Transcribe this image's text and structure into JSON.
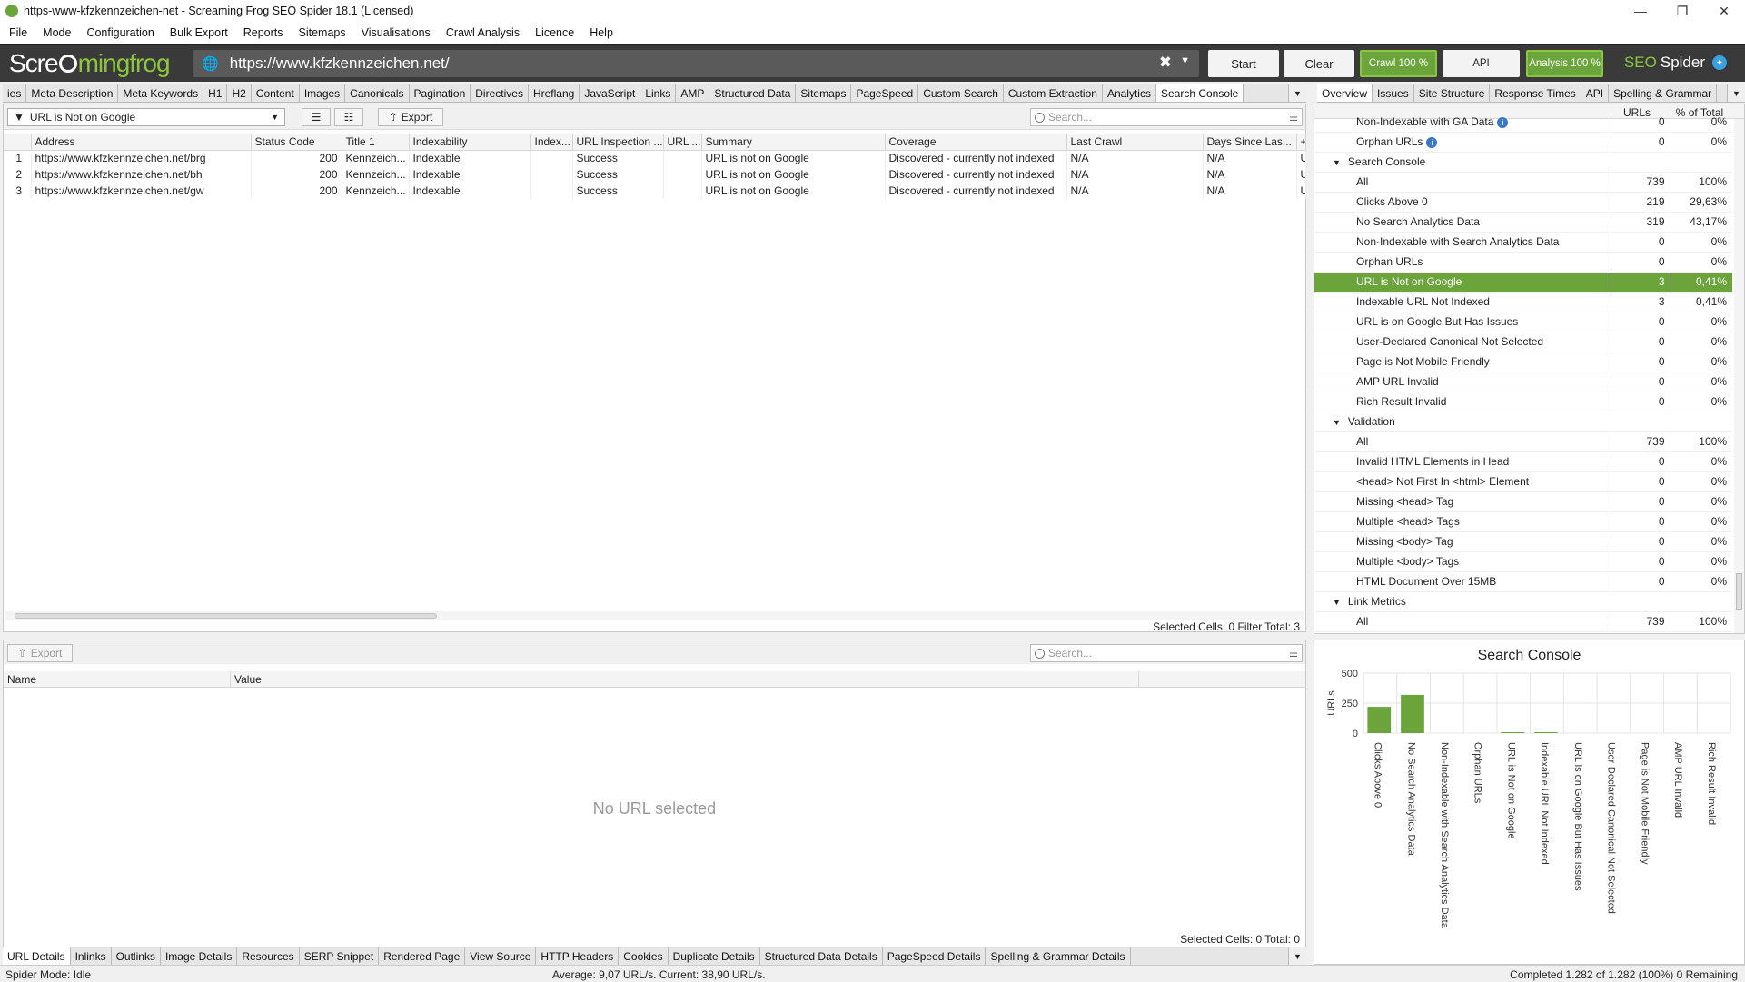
{
  "window": {
    "title": "https-www-kfzkennzeichen-net - Screaming Frog SEO Spider 18.1 (Licensed)"
  },
  "menu": [
    "File",
    "Mode",
    "Configuration",
    "Bulk Export",
    "Reports",
    "Sitemaps",
    "Visualisations",
    "Crawl Analysis",
    "Licence",
    "Help"
  ],
  "toolbar": {
    "brand_pre": "Scre",
    "brand_post": "mingfrog",
    "url": "https://www.kfzkennzeichen.net/",
    "start": "Start",
    "clear": "Clear",
    "crawl": "Crawl 100 %",
    "api": "API",
    "analysis": "Analysis 100 %",
    "seo": "SEO",
    "spider": "Spider"
  },
  "left_tabs": [
    "ies",
    "Meta Description",
    "Meta Keywords",
    "H1",
    "H2",
    "Content",
    "Images",
    "Canonicals",
    "Pagination",
    "Directives",
    "Hreflang",
    "JavaScript",
    "Links",
    "AMP",
    "Structured Data",
    "Sitemaps",
    "PageSpeed",
    "Custom Search",
    "Custom Extraction",
    "Analytics",
    "Search Console"
  ],
  "right_tabs": [
    "Overview",
    "Issues",
    "Site Structure",
    "Response Times",
    "API",
    "Spelling & Grammar"
  ],
  "filter": {
    "selected": "URL is Not on Google",
    "export": "Export",
    "search_placeholder": "Search..."
  },
  "main_table": {
    "columns": [
      "",
      "Address",
      "Status Code",
      "Title 1",
      "Indexability",
      "Index...",
      "URL Inspection ...",
      "URL ...",
      "Summary",
      "Coverage",
      "Last Crawl",
      "Days Since Las...",
      "+"
    ],
    "rows": [
      [
        "1",
        "https://www.kfzkennzeichen.net/brg",
        "200",
        "Kennzeich...",
        "Indexable",
        "",
        "Success",
        "",
        "URL is not on Google",
        "Discovered - currently not indexed",
        "N/A",
        "N/A",
        "Ur"
      ],
      [
        "2",
        "https://www.kfzkennzeichen.net/bh",
        "200",
        "Kennzeich...",
        "Indexable",
        "",
        "Success",
        "",
        "URL is not on Google",
        "Discovered - currently not indexed",
        "N/A",
        "N/A",
        "Ur"
      ],
      [
        "3",
        "https://www.kfzkennzeichen.net/gw",
        "200",
        "Kennzeich...",
        "Indexable",
        "",
        "Success",
        "",
        "URL is not on Google",
        "Discovered - currently not indexed",
        "N/A",
        "N/A",
        "Ur"
      ]
    ],
    "selected_cells": "Selected Cells:  0  Filter Total:  3"
  },
  "lower": {
    "export": "Export",
    "search_placeholder": "Search...",
    "col_name": "Name",
    "col_value": "Value",
    "empty": "No URL selected",
    "total": "Selected Cells:  0  Total:  0"
  },
  "bottom_tabs": [
    "URL Details",
    "Inlinks",
    "Outlinks",
    "Image Details",
    "Resources",
    "SERP Snippet",
    "Rendered Page",
    "View Source",
    "HTTP Headers",
    "Cookies",
    "Duplicate Details",
    "Structured Data Details",
    "PageSpeed Details",
    "Spelling & Grammar Details"
  ],
  "status": {
    "mode": "Spider Mode: Idle",
    "speed": "Average: 9,07 URL/s. Current: 38,90 URL/s.",
    "completed": "Completed 1.282 of 1.282 (100%) 0 Remaining"
  },
  "overview": {
    "col_urls": "URLs",
    "col_pct": "% of Total",
    "rows": [
      {
        "type": "item",
        "label": "Non-Indexable with GA Data",
        "urls": "0",
        "pct": "0%",
        "info": true
      },
      {
        "type": "item",
        "label": "Orphan URLs",
        "urls": "0",
        "pct": "0%",
        "info": true
      },
      {
        "type": "group",
        "label": "Search Console"
      },
      {
        "type": "item",
        "label": "All",
        "urls": "739",
        "pct": "100%"
      },
      {
        "type": "item",
        "label": "Clicks Above 0",
        "urls": "219",
        "pct": "29,63%"
      },
      {
        "type": "item",
        "label": "No Search Analytics Data",
        "urls": "319",
        "pct": "43,17%"
      },
      {
        "type": "item",
        "label": "Non-Indexable with Search Analytics Data",
        "urls": "0",
        "pct": "0%"
      },
      {
        "type": "item",
        "label": "Orphan URLs",
        "urls": "0",
        "pct": "0%"
      },
      {
        "type": "item",
        "label": "URL is Not on Google",
        "urls": "3",
        "pct": "0,41%",
        "selected": true
      },
      {
        "type": "item",
        "label": "Indexable URL Not Indexed",
        "urls": "3",
        "pct": "0,41%"
      },
      {
        "type": "item",
        "label": "URL is on Google But Has Issues",
        "urls": "0",
        "pct": "0%"
      },
      {
        "type": "item",
        "label": "User-Declared Canonical Not Selected",
        "urls": "0",
        "pct": "0%"
      },
      {
        "type": "item",
        "label": "Page is Not Mobile Friendly",
        "urls": "0",
        "pct": "0%"
      },
      {
        "type": "item",
        "label": "AMP URL Invalid",
        "urls": "0",
        "pct": "0%"
      },
      {
        "type": "item",
        "label": "Rich Result Invalid",
        "urls": "0",
        "pct": "0%"
      },
      {
        "type": "group",
        "label": "Validation"
      },
      {
        "type": "item",
        "label": "All",
        "urls": "739",
        "pct": "100%"
      },
      {
        "type": "item",
        "label": "Invalid HTML Elements in Head",
        "urls": "0",
        "pct": "0%"
      },
      {
        "type": "item",
        "label": "<head> Not First In <html> Element",
        "urls": "0",
        "pct": "0%"
      },
      {
        "type": "item",
        "label": "Missing <head> Tag",
        "urls": "0",
        "pct": "0%"
      },
      {
        "type": "item",
        "label": "Multiple <head> Tags",
        "urls": "0",
        "pct": "0%"
      },
      {
        "type": "item",
        "label": "Missing <body> Tag",
        "urls": "0",
        "pct": "0%"
      },
      {
        "type": "item",
        "label": "Multiple <body> Tags",
        "urls": "0",
        "pct": "0%"
      },
      {
        "type": "item",
        "label": "HTML Document Over 15MB",
        "urls": "0",
        "pct": "0%"
      },
      {
        "type": "group",
        "label": "Link Metrics"
      },
      {
        "type": "item",
        "label": "All",
        "urls": "739",
        "pct": "100%"
      }
    ]
  },
  "chart_data": {
    "type": "bar",
    "title": "Search Console",
    "ylabel": "URLs",
    "xlabel": "",
    "ylim": [
      0,
      500
    ],
    "yticks": [
      0,
      250,
      500
    ],
    "categories": [
      "Clicks Above 0",
      "No Search Analytics Data",
      "Non-Indexable with Search Analytics Data",
      "Orphan URLs",
      "URL is Not on Google",
      "Indexable URL Not Indexed",
      "URL is on Google But Has Issues",
      "User-Declared Canonical Not Selected",
      "Page is Not Mobile Friendly",
      "AMP URL Invalid",
      "Rich Result Invalid"
    ],
    "values": [
      219,
      319,
      0,
      0,
      3,
      3,
      0,
      0,
      0,
      0,
      0
    ],
    "color": "#6aa43a",
    "grid": true
  }
}
